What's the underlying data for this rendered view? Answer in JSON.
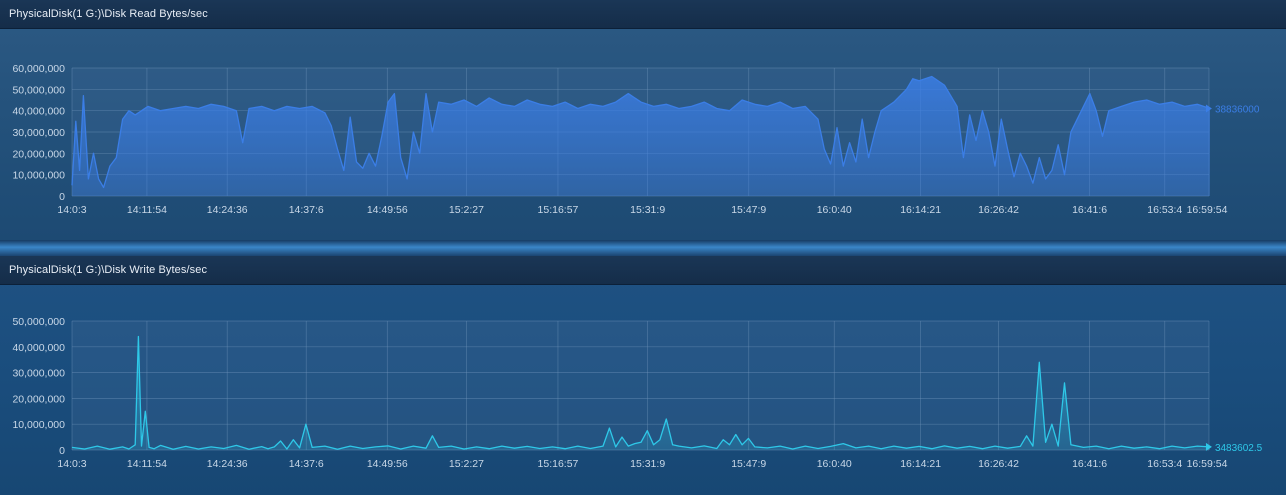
{
  "chart_data": [
    {
      "type": "area",
      "title": "PhysicalDisk(1 G:)\\Disk Read Bytes/sec",
      "x_ticks": [
        "14:0:3",
        "14:11:54",
        "14:24:36",
        "14:37:6",
        "14:49:56",
        "15:2:27",
        "15:16:57",
        "15:31:9",
        "15:47:9",
        "16:0:40",
        "16:14:21",
        "16:26:42",
        "16:41:6",
        "16:53:4",
        "16:59:54"
      ],
      "y_ticks": [
        "0",
        "10,000,000",
        "20,000,000",
        "30,000,000",
        "40,000,000",
        "50,000,000",
        "60,000,000"
      ],
      "ylim": [
        0,
        60000000
      ],
      "xlim_minutes": [
        0,
        179.85
      ],
      "last_value_label": "38836000",
      "color": "#3b7ee6",
      "series": [
        {
          "points": [
            [
              0,
              5000000
            ],
            [
              0.6,
              35000000
            ],
            [
              1.2,
              12000000
            ],
            [
              1.8,
              47000000
            ],
            [
              2.6,
              8000000
            ],
            [
              3.4,
              20000000
            ],
            [
              4.2,
              8000000
            ],
            [
              5,
              4000000
            ],
            [
              6,
              14000000
            ],
            [
              7,
              18000000
            ],
            [
              8,
              36000000
            ],
            [
              9,
              40000000
            ],
            [
              10,
              38000000
            ],
            [
              12,
              42000000
            ],
            [
              14,
              40000000
            ],
            [
              16,
              41000000
            ],
            [
              18,
              42000000
            ],
            [
              20,
              41000000
            ],
            [
              22,
              43000000
            ],
            [
              24,
              42000000
            ],
            [
              26,
              40000000
            ],
            [
              27,
              25000000
            ],
            [
              28,
              41000000
            ],
            [
              30,
              42000000
            ],
            [
              32,
              40000000
            ],
            [
              34,
              42000000
            ],
            [
              36,
              41000000
            ],
            [
              38,
              42000000
            ],
            [
              40,
              39000000
            ],
            [
              41,
              33000000
            ],
            [
              42,
              22000000
            ],
            [
              43,
              12000000
            ],
            [
              44,
              37000000
            ],
            [
              45,
              16000000
            ],
            [
              46,
              13000000
            ],
            [
              47,
              20000000
            ],
            [
              48,
              14000000
            ],
            [
              49,
              28000000
            ],
            [
              50,
              44000000
            ],
            [
              51,
              48000000
            ],
            [
              52,
              18000000
            ],
            [
              53,
              8000000
            ],
            [
              54,
              30000000
            ],
            [
              55,
              20000000
            ],
            [
              56,
              48000000
            ],
            [
              57,
              30000000
            ],
            [
              58,
              44000000
            ],
            [
              60,
              43000000
            ],
            [
              62,
              45000000
            ],
            [
              64,
              42000000
            ],
            [
              66,
              46000000
            ],
            [
              68,
              43000000
            ],
            [
              70,
              42000000
            ],
            [
              72,
              45000000
            ],
            [
              74,
              43000000
            ],
            [
              76,
              42000000
            ],
            [
              78,
              44000000
            ],
            [
              80,
              41000000
            ],
            [
              82,
              43000000
            ],
            [
              84,
              42000000
            ],
            [
              86,
              44000000
            ],
            [
              88,
              48000000
            ],
            [
              90,
              44000000
            ],
            [
              92,
              42000000
            ],
            [
              94,
              43000000
            ],
            [
              96,
              41000000
            ],
            [
              98,
              42000000
            ],
            [
              100,
              44000000
            ],
            [
              102,
              41000000
            ],
            [
              104,
              40000000
            ],
            [
              106,
              45000000
            ],
            [
              108,
              43000000
            ],
            [
              110,
              42000000
            ],
            [
              112,
              44000000
            ],
            [
              114,
              41000000
            ],
            [
              116,
              42000000
            ],
            [
              118,
              36000000
            ],
            [
              119,
              22000000
            ],
            [
              120,
              15000000
            ],
            [
              121,
              32000000
            ],
            [
              122,
              14000000
            ],
            [
              123,
              25000000
            ],
            [
              124,
              16000000
            ],
            [
              125,
              36000000
            ],
            [
              126,
              18000000
            ],
            [
              127,
              30000000
            ],
            [
              128,
              40000000
            ],
            [
              130,
              44000000
            ],
            [
              132,
              50000000
            ],
            [
              133,
              55000000
            ],
            [
              134,
              54000000
            ],
            [
              136,
              56000000
            ],
            [
              138,
              52000000
            ],
            [
              140,
              42000000
            ],
            [
              141,
              18000000
            ],
            [
              142,
              38000000
            ],
            [
              143,
              26000000
            ],
            [
              144,
              40000000
            ],
            [
              145,
              30000000
            ],
            [
              146,
              14000000
            ],
            [
              147,
              36000000
            ],
            [
              148,
              22000000
            ],
            [
              149,
              9000000
            ],
            [
              150,
              20000000
            ],
            [
              151,
              14000000
            ],
            [
              152,
              6000000
            ],
            [
              153,
              18000000
            ],
            [
              154,
              8000000
            ],
            [
              155,
              12000000
            ],
            [
              156,
              24000000
            ],
            [
              157,
              10000000
            ],
            [
              158,
              30000000
            ],
            [
              159,
              36000000
            ],
            [
              160,
              42000000
            ],
            [
              161,
              48000000
            ],
            [
              162,
              40000000
            ],
            [
              163,
              28000000
            ],
            [
              164,
              40000000
            ],
            [
              166,
              42000000
            ],
            [
              168,
              44000000
            ],
            [
              170,
              45000000
            ],
            [
              172,
              43000000
            ],
            [
              174,
              44000000
            ],
            [
              176,
              42000000
            ],
            [
              178,
              43000000
            ],
            [
              180,
              41000000
            ]
          ]
        }
      ]
    },
    {
      "type": "area",
      "title": "PhysicalDisk(1 G:)\\Disk Write Bytes/sec",
      "x_ticks": [
        "14:0:3",
        "14:11:54",
        "14:24:36",
        "14:37:6",
        "14:49:56",
        "15:2:27",
        "15:16:57",
        "15:31:9",
        "15:47:9",
        "16:0:40",
        "16:14:21",
        "16:26:42",
        "16:41:6",
        "16:53:4",
        "16:59:54"
      ],
      "y_ticks": [
        "0",
        "10,000,000",
        "20,000,000",
        "30,000,000",
        "40,000,000",
        "50,000,000"
      ],
      "ylim": [
        0,
        50000000
      ],
      "xlim_minutes": [
        0,
        179.85
      ],
      "last_value_label": "3483602.5",
      "color": "#2ec8e8",
      "series": [
        {
          "points": [
            [
              0,
              1000000
            ],
            [
              2,
              400000
            ],
            [
              4,
              1500000
            ],
            [
              6,
              300000
            ],
            [
              8,
              1200000
            ],
            [
              9,
              400000
            ],
            [
              10,
              2000000
            ],
            [
              10.5,
              44000000
            ],
            [
              11,
              1500000
            ],
            [
              11.6,
              15000000
            ],
            [
              12.2,
              1000000
            ],
            [
              13,
              500000
            ],
            [
              14,
              1800000
            ],
            [
              16,
              300000
            ],
            [
              18,
              1400000
            ],
            [
              20,
              400000
            ],
            [
              22,
              1200000
            ],
            [
              24,
              600000
            ],
            [
              26,
              1800000
            ],
            [
              28,
              300000
            ],
            [
              30,
              1300000
            ],
            [
              31,
              500000
            ],
            [
              32,
              1200000
            ],
            [
              33,
              3500000
            ],
            [
              34,
              400000
            ],
            [
              35,
              4000000
            ],
            [
              36,
              800000
            ],
            [
              37,
              10000000
            ],
            [
              38,
              1000000
            ],
            [
              40,
              1500000
            ],
            [
              42,
              300000
            ],
            [
              44,
              1500000
            ],
            [
              46,
              600000
            ],
            [
              48,
              1200000
            ],
            [
              50,
              1600000
            ],
            [
              52,
              400000
            ],
            [
              54,
              1500000
            ],
            [
              56,
              700000
            ],
            [
              57,
              5500000
            ],
            [
              58,
              1000000
            ],
            [
              60,
              1500000
            ],
            [
              62,
              400000
            ],
            [
              64,
              1200000
            ],
            [
              66,
              500000
            ],
            [
              68,
              1500000
            ],
            [
              70,
              700000
            ],
            [
              72,
              1400000
            ],
            [
              74,
              600000
            ],
            [
              76,
              1200000
            ],
            [
              78,
              500000
            ],
            [
              80,
              1500000
            ],
            [
              82,
              600000
            ],
            [
              84,
              1500000
            ],
            [
              85,
              8500000
            ],
            [
              86,
              1200000
            ],
            [
              87,
              5000000
            ],
            [
              88,
              1500000
            ],
            [
              89,
              2500000
            ],
            [
              90,
              3000000
            ],
            [
              91,
              7500000
            ],
            [
              92,
              2000000
            ],
            [
              93,
              4000000
            ],
            [
              94,
              12000000
            ],
            [
              95,
              2000000
            ],
            [
              96,
              1500000
            ],
            [
              98,
              800000
            ],
            [
              100,
              1600000
            ],
            [
              102,
              600000
            ],
            [
              103,
              4000000
            ],
            [
              104,
              2000000
            ],
            [
              105,
              6000000
            ],
            [
              106,
              2000000
            ],
            [
              107,
              4500000
            ],
            [
              108,
              1200000
            ],
            [
              110,
              800000
            ],
            [
              112,
              1500000
            ],
            [
              114,
              400000
            ],
            [
              116,
              1500000
            ],
            [
              118,
              600000
            ],
            [
              120,
              1400000
            ],
            [
              122,
              2500000
            ],
            [
              124,
              800000
            ],
            [
              126,
              1500000
            ],
            [
              128,
              500000
            ],
            [
              130,
              1500000
            ],
            [
              132,
              700000
            ],
            [
              134,
              1400000
            ],
            [
              136,
              500000
            ],
            [
              138,
              1600000
            ],
            [
              140,
              700000
            ],
            [
              142,
              1400000
            ],
            [
              144,
              500000
            ],
            [
              146,
              1500000
            ],
            [
              148,
              700000
            ],
            [
              150,
              1400000
            ],
            [
              151,
              5500000
            ],
            [
              152,
              1500000
            ],
            [
              153,
              34000000
            ],
            [
              154,
              3000000
            ],
            [
              155,
              10000000
            ],
            [
              156,
              1500000
            ],
            [
              157,
              26000000
            ],
            [
              158,
              2000000
            ],
            [
              160,
              1000000
            ],
            [
              162,
              1500000
            ],
            [
              164,
              500000
            ],
            [
              166,
              1500000
            ],
            [
              168,
              700000
            ],
            [
              170,
              1200000
            ],
            [
              172,
              500000
            ],
            [
              174,
              1500000
            ],
            [
              176,
              800000
            ],
            [
              178,
              1500000
            ],
            [
              180,
              1200000
            ]
          ]
        }
      ]
    }
  ]
}
